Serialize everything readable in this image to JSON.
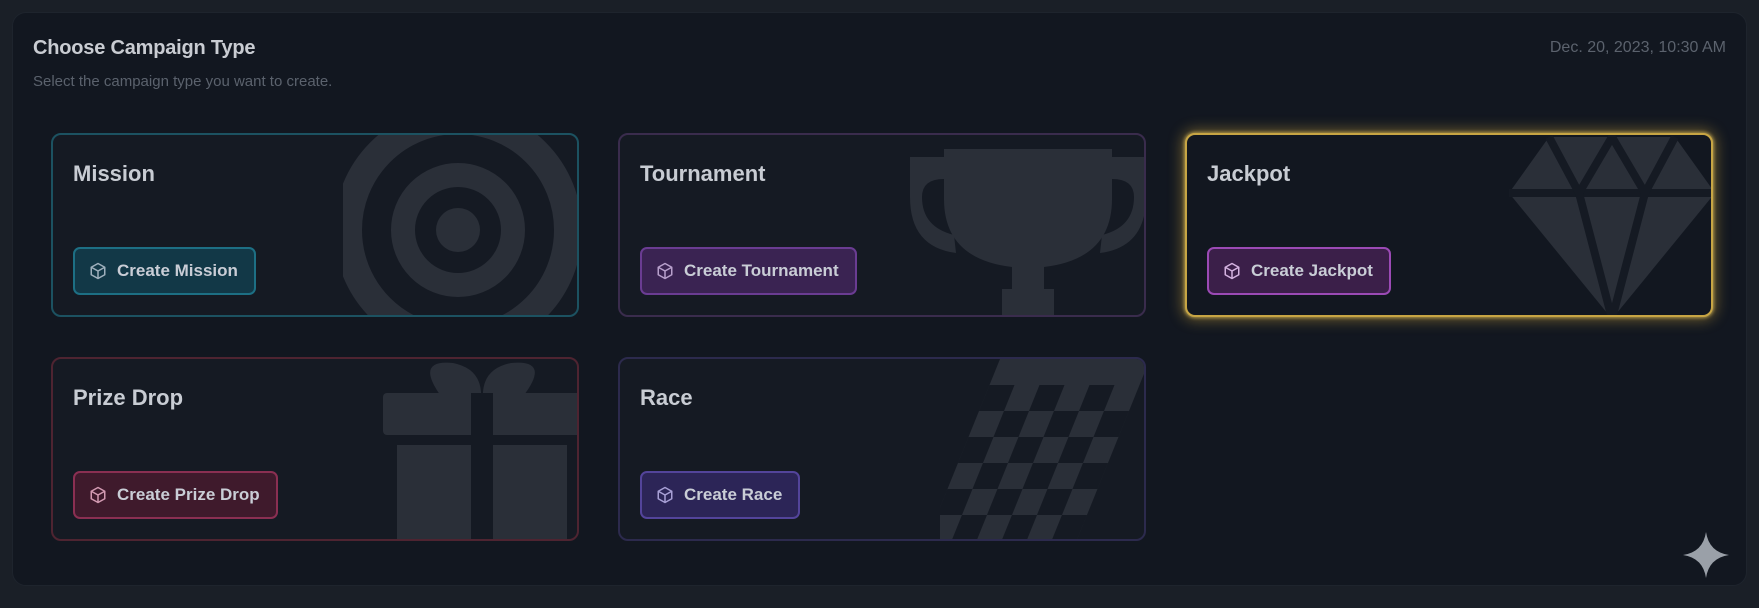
{
  "header": {
    "title": "Choose Campaign Type",
    "subtitle": "Select the campaign type you want to create.",
    "timestamp": "Dec. 20, 2023, 10:30 AM"
  },
  "cards": [
    {
      "title": "Mission",
      "button": "Create Mission",
      "art_icon": "target-icon"
    },
    {
      "title": "Tournament",
      "button": "Create Tournament",
      "art_icon": "trophy-icon"
    },
    {
      "title": "Jackpot",
      "button": "Create Jackpot",
      "art_icon": "diamond-icon",
      "selected": true
    },
    {
      "title": "Prize Drop",
      "button": "Create Prize Drop",
      "art_icon": "gift-icon"
    },
    {
      "title": "Race",
      "button": "Create Race",
      "art_icon": "checkered-flag-icon"
    }
  ],
  "colors": {
    "mission": "#1d6f84",
    "tournament": "#6a3c92",
    "jackpot_highlight": "#c7a544",
    "prize_drop": "#8a2f52",
    "race": "#53449a"
  }
}
